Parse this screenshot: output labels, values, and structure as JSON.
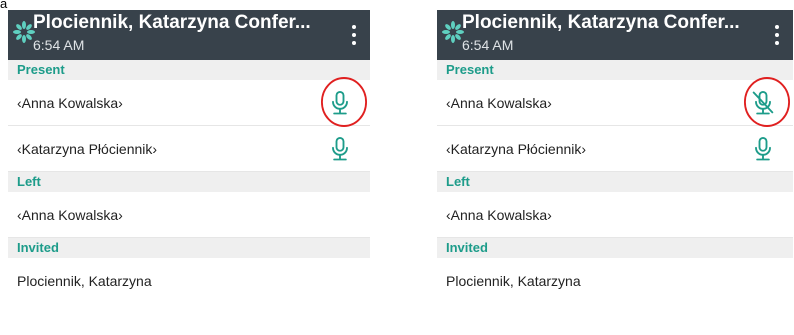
{
  "figure_label": "a)",
  "screens": [
    {
      "header": {
        "title": "Plociennik, Katarzyna Confer...",
        "time": "6:54 AM"
      },
      "sections": [
        {
          "label": "Present",
          "items": [
            {
              "name": "‹Anna Kowalska›",
              "mic": "microphone-icon",
              "highlighted": true
            },
            {
              "name": "‹Katarzyna Płóciennik›",
              "mic": "microphone-icon",
              "highlighted": false
            }
          ]
        },
        {
          "label": "Left",
          "items": [
            {
              "name": "‹Anna Kowalska›"
            }
          ]
        },
        {
          "label": "Invited",
          "items": [
            {
              "name": "Plociennik, Katarzyna"
            }
          ]
        }
      ]
    },
    {
      "header": {
        "title": "Plociennik, Katarzyna Confer...",
        "time": "6:54 AM"
      },
      "sections": [
        {
          "label": "Present",
          "items": [
            {
              "name": "‹Anna Kowalska›",
              "mic": "microphone-muted-icon",
              "highlighted": true
            },
            {
              "name": "‹Katarzyna Płóciennik›",
              "mic": "microphone-icon",
              "highlighted": false
            }
          ]
        },
        {
          "label": "Left",
          "items": [
            {
              "name": "‹Anna Kowalska›"
            }
          ]
        },
        {
          "label": "Invited",
          "items": [
            {
              "name": "Plociennik, Katarzyna"
            }
          ]
        }
      ]
    }
  ],
  "colors": {
    "appbar": "#38424b",
    "accent": "#1d9c8a",
    "highlight_ring": "#e02020",
    "section_bg": "#efefef"
  }
}
